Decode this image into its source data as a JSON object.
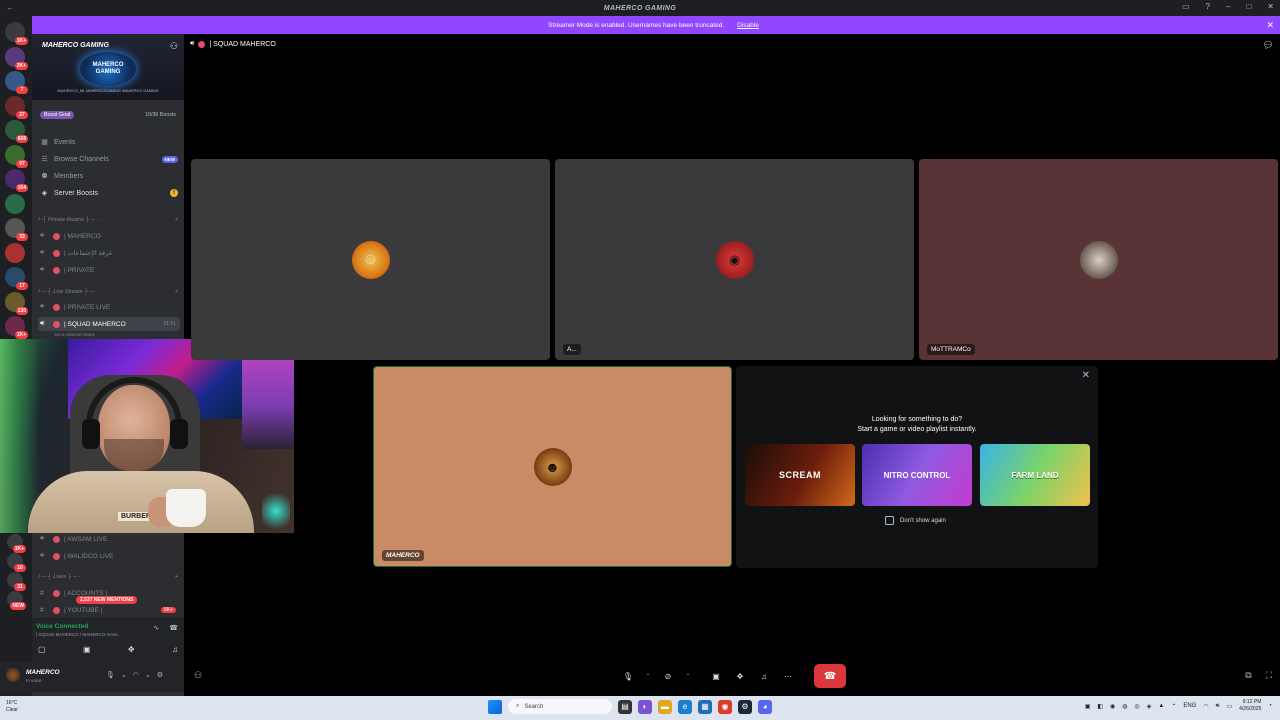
{
  "window": {
    "title": "MAHERCO GAMING"
  },
  "banner": {
    "text": "Streamer Mode is enabled. Usernames have been truncated.",
    "disable_label": "Disable"
  },
  "rail": {
    "servers": [
      {
        "badge": "1K+",
        "color": "#3a3b40"
      },
      {
        "badge": "2K+",
        "color": "#5a3a7a"
      },
      {
        "badge": "7",
        "color": "#355a8a"
      },
      {
        "badge": "27",
        "color": "#6b2a2a"
      },
      {
        "badge": "668",
        "color": "#2a5a3a"
      },
      {
        "badge": "97",
        "color": "#3a6b2a"
      },
      {
        "badge": "164",
        "color": "#4a2a6b"
      },
      {
        "badge": "",
        "color": "#2a6b4a"
      },
      {
        "badge": "33",
        "color": "#555555"
      },
      {
        "badge": "",
        "color": "#a83232"
      },
      {
        "badge": "17",
        "color": "#2a4a6b"
      },
      {
        "badge": "130",
        "color": "#6b5a2a"
      },
      {
        "badge": "1K+",
        "color": "#6b2a4a"
      }
    ],
    "lower_badges": [
      "1K+",
      "10",
      "31",
      "NEW"
    ]
  },
  "server": {
    "name": "MAHERCO GAMING",
    "logo_text": "MAHERCO GAMING",
    "logo_sub": "/MAHERCO_ML   MAHERCOGAMING   /MAHERCO GAMING",
    "boost_goal": "Boost Goal",
    "boost_count": "10/36 Boosts"
  },
  "nav": {
    "events": "Events",
    "browse": "Browse Channels",
    "browse_badge": "NEW",
    "members": "Members",
    "boosts": "Server Boosts",
    "boosts_badge": "!"
  },
  "categories": {
    "private": "⊦ ┤ Private Rooms ├ ─ · ·",
    "live": "⊦ ─ ┤ Live Stream ├ ─ · ·",
    "lives": "⊦ ─ ┤ Lives ├ ─ · ·"
  },
  "channels": {
    "maherco": "| MAHERCO",
    "arabic": "| غرفة الإجتماعات",
    "private": "| PRIVATE",
    "private_live": "| PRIVATE LIVE",
    "squad": "| SQUAD MAHERCO",
    "squad_time": "21:51",
    "squad_status": "Set a channel status",
    "awsam": "| AWSAM LIVE",
    "walidco": "| WALIDCO LIVE",
    "accounts": "| ACCOUNTS |",
    "youtube": "| YOUTUBE |",
    "mentions": "2,537 NEW MENTIONS",
    "youtube_badge": "5K+"
  },
  "voice": {
    "status": "Voice Connected",
    "channel": "| SQUAD MAHERCO / MAHERCO GAM..."
  },
  "user": {
    "name": "MAHERCO",
    "status": "In voice"
  },
  "webcam": {
    "shirt": "BURBERRY"
  },
  "call": {
    "channel": "| SQUAD MAHERCO",
    "tiles": [
      {
        "label": "",
        "bg": "#3a3a3c"
      },
      {
        "label": "A...",
        "bg": "#3a3a3c"
      },
      {
        "label": "MoTTRAMCo",
        "bg": "#5a3337"
      },
      {
        "label": "MAHERCO",
        "bg": "#c98a66"
      }
    ]
  },
  "activity": {
    "line1": "Looking for something to do?",
    "line2": "Start a game or video playlist instantly.",
    "games": [
      {
        "title": "SCREAM"
      },
      {
        "title": "NITRO CONTROL"
      },
      {
        "title": "FARM LAND"
      }
    ],
    "dont_show": "Don't show again"
  },
  "taskbar": {
    "weather_temp": "16°C",
    "weather_desc": "Clear",
    "search": "Search",
    "lang": "ENG",
    "time": "8:12 PM",
    "date": "4/26/2025"
  }
}
